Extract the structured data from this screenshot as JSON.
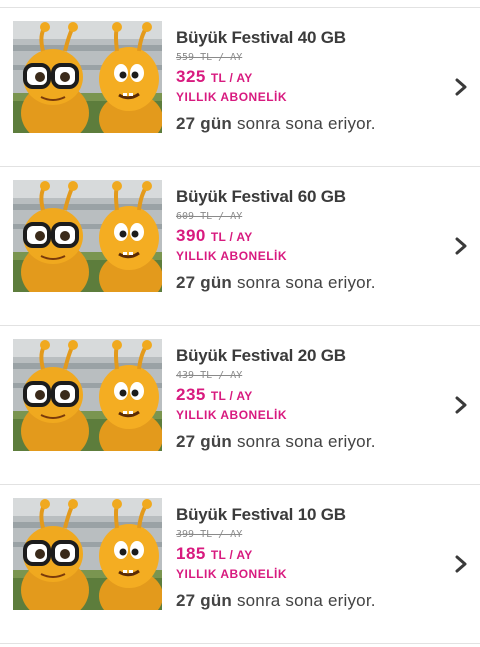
{
  "packages": [
    {
      "title": "Büyük Festival 40 GB",
      "old_price": "559 TL / AY",
      "price": "325",
      "price_unit": "TL / AY",
      "subscription_type": "YILLIK ABONELİK",
      "expiry_days": "27 gün",
      "expiry_text": "sonra sona eriyor."
    },
    {
      "title": "Büyük Festival 60 GB",
      "old_price": "609 TL / AY",
      "price": "390",
      "price_unit": "TL / AY",
      "subscription_type": "YILLIK ABONELİK",
      "expiry_days": "27 gün",
      "expiry_text": "sonra sona eriyor."
    },
    {
      "title": "Büyük Festival 20 GB",
      "old_price": "439 TL / AY",
      "price": "235",
      "price_unit": "TL / AY",
      "subscription_type": "YILLIK ABONELİK",
      "expiry_days": "27 gün",
      "expiry_text": "sonra sona eriyor."
    },
    {
      "title": "Büyük Festival 10 GB",
      "old_price": "399 TL / AY",
      "price": "185",
      "price_unit": "TL / AY",
      "subscription_type": "YILLIK ABONELİK",
      "expiry_days": "27 gün",
      "expiry_text": "sonra sona eriyor."
    }
  ],
  "icons": {
    "chevron": "chevron-right-icon",
    "thumbnail": "festival-mascot-image"
  },
  "colors": {
    "accent": "#d81a7f",
    "title": "#3b3b3b",
    "muted": "#8a8a8a",
    "divider": "#e2e2e2"
  }
}
